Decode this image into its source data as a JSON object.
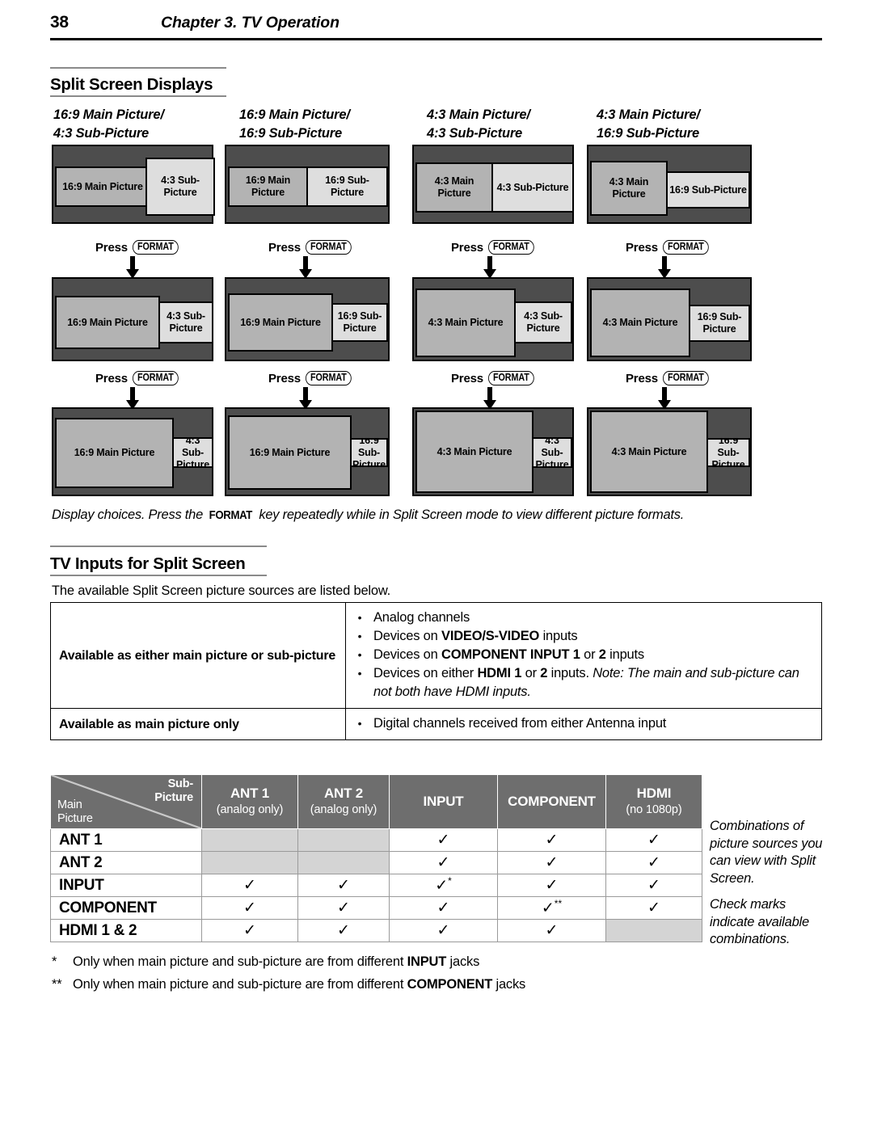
{
  "running_head": {
    "page_number": "38",
    "chapter": "Chapter 3. TV Operation"
  },
  "sections": {
    "split_screen_displays": "Split Screen Displays",
    "tv_inputs": "TV Inputs for Split Screen",
    "tv_inputs_intro": "The available Split Screen picture sources are listed below."
  },
  "diagram": {
    "press_word": "Press",
    "format_key": "FORMAT",
    "columns": [
      {
        "caption_line1": "16:9 Main Picture/",
        "caption_line2": "4:3 Sub-Picture",
        "main_label": "16:9 Main Picture",
        "sub_label": "4:3 Sub-Picture"
      },
      {
        "caption_line1": "16:9 Main Picture/",
        "caption_line2": "16:9 Sub-Picture",
        "main_label": "16:9 Main Picture",
        "sub_label": "16:9 Sub-Picture"
      },
      {
        "caption_line1": "4:3 Main Picture/",
        "caption_line2": "4:3 Sub-Picture",
        "main_label": "4:3 Main Picture",
        "sub_label": "4:3 Sub-Picture"
      },
      {
        "caption_line1": "4:3 Main Picture/",
        "caption_line2": "16:9 Sub-Picture",
        "main_label": "4:3 Main Picture",
        "sub_label": "16:9 Sub-Picture"
      }
    ],
    "caption": {
      "before": "Display choices.  Press the ",
      "key": "FORMAT",
      "after": " key repeatedly while in Split Screen mode to view different picture formats."
    }
  },
  "sources_table": {
    "rows": [
      {
        "label": "Available as either main picture or sub-picture",
        "bullets": [
          {
            "segments": [
              {
                "t": "Analog channels",
                "s": "n"
              }
            ]
          },
          {
            "segments": [
              {
                "t": "Devices on ",
                "s": "n"
              },
              {
                "t": "VIDEO/S-VIDEO",
                "s": "b"
              },
              {
                "t": " inputs",
                "s": "n"
              }
            ]
          },
          {
            "segments": [
              {
                "t": "Devices on ",
                "s": "n"
              },
              {
                "t": "COMPONENT INPUT 1",
                "s": "b"
              },
              {
                "t": " or ",
                "s": "n"
              },
              {
                "t": "2",
                "s": "b"
              },
              {
                "t": " inputs",
                "s": "n"
              }
            ]
          },
          {
            "segments": [
              {
                "t": "Devices on either ",
                "s": "n"
              },
              {
                "t": "HDMI 1",
                "s": "b"
              },
              {
                "t": " or ",
                "s": "n"
              },
              {
                "t": "2",
                "s": "b"
              },
              {
                "t": " inputs. ",
                "s": "n"
              },
              {
                "t": "Note: The main and sub-picture can not both have HDMI inputs.",
                "s": "i"
              }
            ]
          }
        ]
      },
      {
        "label": "Available as main picture only",
        "bullets": [
          {
            "segments": [
              {
                "t": "Digital channels received from either Antenna input",
                "s": "n"
              }
            ]
          }
        ]
      }
    ],
    "bullet_glyph": "•"
  },
  "matrix": {
    "corner": {
      "sub": "Sub-\nPicture",
      "sub_l1": "Sub-",
      "sub_l2": "Picture",
      "main_l1": "Main",
      "main_l2": "Picture"
    },
    "columns": [
      {
        "title": "ANT 1",
        "sub": "(analog only)"
      },
      {
        "title": "ANT 2",
        "sub": "(analog only)"
      },
      {
        "title": "INPUT",
        "sub": ""
      },
      {
        "title": "COMPONENT",
        "sub": ""
      },
      {
        "title": "HDMI",
        "sub": "(no 1080p)"
      }
    ],
    "rows": [
      {
        "label": "ANT 1",
        "cells": [
          "",
          "",
          "check",
          "check",
          "check"
        ]
      },
      {
        "label": "ANT 2",
        "cells": [
          "",
          "",
          "check",
          "check",
          "check"
        ]
      },
      {
        "label": "INPUT",
        "cells": [
          "check",
          "check",
          "check*",
          "check",
          "check"
        ]
      },
      {
        "label": "COMPONENT",
        "cells": [
          "check",
          "check",
          "check",
          "check**",
          "check"
        ]
      },
      {
        "label": "HDMI 1 & 2",
        "cells": [
          "check",
          "check",
          "check",
          "check",
          ""
        ]
      }
    ],
    "check_glyph": "✓"
  },
  "side_note": {
    "p1": "Combinations of picture sources you can view with Split Screen.",
    "p2": "Check marks indicate available combinations."
  },
  "footnotes": [
    {
      "mark": "*",
      "before": "Only when main picture and sub-picture are from different ",
      "bold": "INPUT",
      "after": " jacks"
    },
    {
      "mark": "**",
      "before": "Only when main picture and sub-picture are from different ",
      "bold": "COMPONENT",
      "after": " jacks"
    }
  ],
  "colors": {
    "frame": "#4d4d4d",
    "main_picture": "#b3b3b3",
    "sub_picture": "#dedede",
    "matrix_header": "#6e6e6e",
    "matrix_disabled": "#d4d4d4"
  }
}
